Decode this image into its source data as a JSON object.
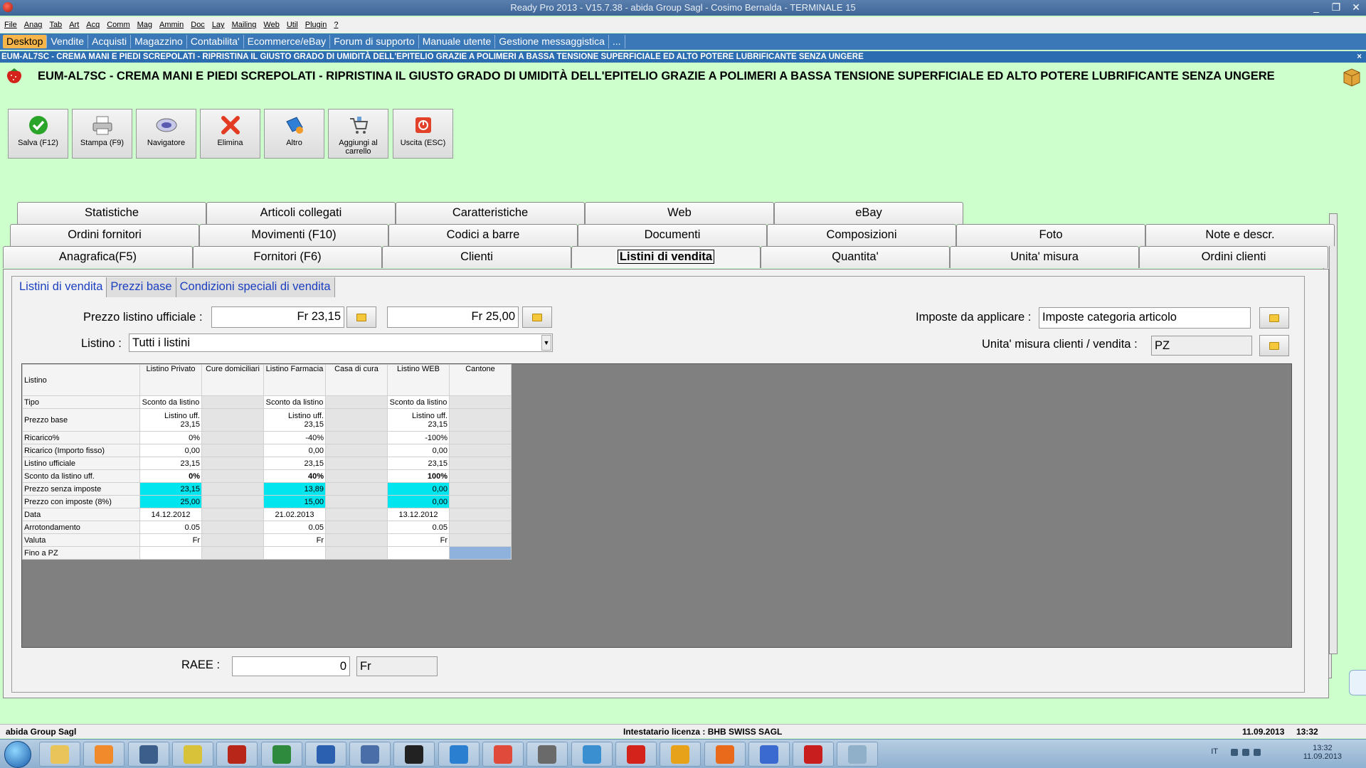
{
  "window": {
    "title": "Ready Pro 2013 - V15.7.38 - abida Group Sagl - Cosimo Bernalda - TERMINALE 15",
    "controls": [
      "_",
      "❐",
      "✕"
    ]
  },
  "menu": [
    "File",
    "Anag",
    "Tab",
    "Art",
    "Acq",
    "Comm",
    "Mag",
    "Ammin",
    "Doc",
    "Lay",
    "Mailing",
    "Web",
    "Util",
    "Plugin",
    "?"
  ],
  "links": [
    "Desktop",
    "Vendite",
    "Acquisti",
    "Magazzino",
    "Contabilita'",
    "Ecommerce/eBay",
    "Forum di supporto",
    "Manuale utente",
    "Gestione messaggistica",
    "..."
  ],
  "info_strip": "EUM-AL7SC - CREMA MANI E PIEDI SCREPOLATI - RIPRISTINA IL GIUSTO GRADO DI UMIDITÀ DELL'EPITELIO GRAZIE A POLIMERI A BASSA TENSIONE SUPERFICIALE ED ALTO POTERE LUBRIFICANTE SENZA UNGERE",
  "info_close": "×",
  "product_title": "EUM-AL7SC - CREMA MANI E PIEDI SCREPOLATI - RIPRISTINA IL GIUSTO GRADO DI UMIDITÀ DELL'EPITELIO GRAZIE A POLIMERI A BASSA TENSIONE SUPERFICIALE ED ALTO POTERE LUBRIFICANTE SENZA UNGERE",
  "commands": [
    {
      "label": "Salva (F12)",
      "icon": "check-icon"
    },
    {
      "label": "Stampa (F9)",
      "icon": "printer-icon"
    },
    {
      "label": "Navigatore",
      "icon": "navigator-icon"
    },
    {
      "label": "Elimina",
      "icon": "delete-x-icon"
    },
    {
      "label": "Altro",
      "icon": "other-icon"
    },
    {
      "label": "Aggiungi al carrello",
      "icon": "cart-icon"
    },
    {
      "label": "Uscita (ESC)",
      "icon": "exit-icon"
    }
  ],
  "tabs": {
    "row1": [
      "Statistiche",
      "Articoli collegati",
      "Caratteristiche",
      "Web",
      "eBay"
    ],
    "row2": [
      "Ordini fornitori",
      "Movimenti (F10)",
      "Codici a barre",
      "Documenti",
      "Composizioni",
      "Foto",
      "Note e descr."
    ],
    "row3": [
      "Anagrafica(F5)",
      "Fornitori (F6)",
      "Clienti",
      "Listini di vendita",
      "Quantita'",
      "Unita' misura",
      "Ordini clienti"
    ],
    "active": "Listini di vendita"
  },
  "subtabs": [
    "Listini di vendita",
    "Prezzi base",
    "Condizioni speciali di vendita"
  ],
  "form": {
    "prezzo_label": "Prezzo listino ufficiale :",
    "prezzo_1": "Fr 23,15",
    "prezzo_2": "Fr 25,00",
    "listino_label": "Listino :",
    "listino_value": "Tutti i listini",
    "imposte_label": "Imposte da applicare :",
    "imposte_value": "Imposte categoria articolo",
    "um_label": "Unita' misura clienti / vendita :",
    "um_value": "PZ",
    "raee_label": "RAEE :",
    "raee_value": "0",
    "raee_currency": "Fr"
  },
  "grid": {
    "corner": "Listino",
    "columns": [
      "Listino Privato",
      "Cure domiciliari",
      "Listino Farmacia",
      "Casa di cura",
      "Listino WEB",
      "Cantone"
    ],
    "rows": [
      {
        "label": "Tipo",
        "cells": [
          "Sconto da listino",
          "",
          "Sconto da listino",
          "",
          "Sconto da listino",
          ""
        ],
        "style": "center"
      },
      {
        "label": "Prezzo base",
        "cells": [
          "Listino uff.\n23,15",
          "",
          "Listino uff.\n23,15",
          "",
          "Listino uff.\n23,15",
          ""
        ],
        "style": "tall"
      },
      {
        "label": "Ricarico%",
        "cells": [
          "0%",
          "",
          "-40%",
          "",
          "-100%",
          ""
        ]
      },
      {
        "label": "Ricarico (Importo fisso)",
        "cells": [
          "0,00",
          "",
          "0,00",
          "",
          "0,00",
          ""
        ]
      },
      {
        "label": "Listino ufficiale",
        "cells": [
          "23,15",
          "",
          "23,15",
          "",
          "23,15",
          ""
        ]
      },
      {
        "label": "Sconto da listino uff.",
        "cells": [
          "0%",
          "",
          "40%",
          "",
          "100%",
          ""
        ],
        "style": "bold"
      },
      {
        "label": "Prezzo senza imposte",
        "cells": [
          "23,15",
          "",
          "13,89",
          "",
          "0,00",
          ""
        ],
        "style": "cyan"
      },
      {
        "label": "Prezzo con imposte (8%)",
        "cells": [
          "25,00",
          "",
          "15,00",
          "",
          "0,00",
          ""
        ],
        "style": "cyan"
      },
      {
        "label": "Data",
        "cells": [
          "14.12.2012",
          "",
          "21.02.2013",
          "",
          "13.12.2012",
          ""
        ],
        "style": "center"
      },
      {
        "label": "Arrotondamento",
        "cells": [
          "0.05",
          "",
          "0.05",
          "",
          "0.05",
          ""
        ]
      },
      {
        "label": "Valuta",
        "cells": [
          "Fr",
          "",
          "Fr",
          "",
          "Fr",
          ""
        ]
      },
      {
        "label": "Fino a PZ",
        "cells": [
          "",
          "",
          "",
          "",
          "",
          ""
        ],
        "style": "last"
      }
    ]
  },
  "status": {
    "company": "abida Group Sagl",
    "license": "Intestatario licenza : BHB SWISS SAGL",
    "date": "11.09.2013",
    "time": "13:32"
  },
  "taskbar": {
    "apps": [
      "explorer",
      "media-player",
      "ie-edge",
      "app-yellow",
      "filezilla",
      "excel",
      "word",
      "network",
      "pm",
      "teamviewer",
      "picasa",
      "gimp",
      "remote-desktop",
      "ready-pro",
      "chrome",
      "firefox",
      "safari",
      "acrobat",
      "notepad"
    ],
    "lang": "IT",
    "clock_time": "13:32",
    "clock_date": "11.09.2013"
  },
  "colors": {
    "background": "#ccffcc",
    "link_bar": "#3a78b8",
    "active_link": "#f7b54a",
    "cyan_cell": "#00e5ee"
  }
}
